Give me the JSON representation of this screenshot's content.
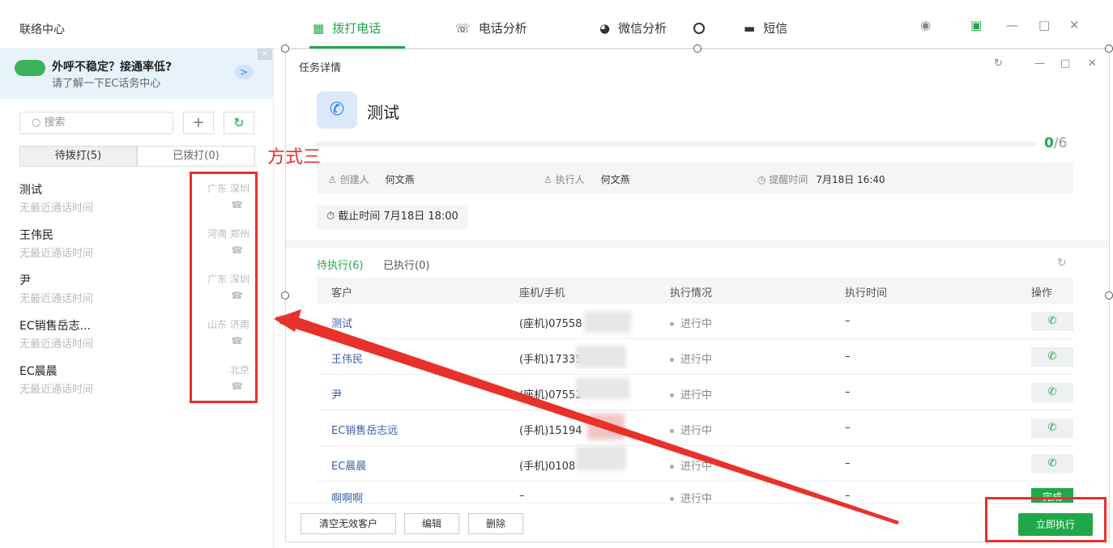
{
  "app": {
    "title": "联络中心"
  },
  "nav": {
    "tabs": [
      {
        "label": "拨打电话"
      },
      {
        "label": "电话分析"
      },
      {
        "label": "微信分析"
      },
      {
        "label": "短信"
      }
    ]
  },
  "banner": {
    "title": "外呼不稳定？接通率低?",
    "subtitle": "请了解一下EC话务中心",
    "arrow": ">",
    "close": "×"
  },
  "left": {
    "search_placeholder": "搜索",
    "plus": "+",
    "segments": [
      "待拨打(5)",
      "已拨打(0)"
    ],
    "contacts": [
      {
        "name": "测试",
        "sub": "无最近通话时间",
        "location": "广东 深圳"
      },
      {
        "name": "王伟民",
        "sub": "无最近通话时间",
        "location": "河南 郑州"
      },
      {
        "name": "尹",
        "sub": "无最近通话时间",
        "location": "广东 深圳"
      },
      {
        "name": "EC销售岳志...",
        "sub": "无最近通话时间",
        "location": "山东 济南"
      },
      {
        "name": "EC晨晨",
        "sub": "无最近通话时间",
        "location": "北京"
      }
    ]
  },
  "annotation": {
    "text": "方式三"
  },
  "dialog": {
    "title": "任务详情",
    "task_name": "测试",
    "progress": {
      "done": "0",
      "total": "/6"
    },
    "creator_label": "创建人",
    "creator": "何文燕",
    "executor_label": "执行人",
    "executor": "何文燕",
    "remind_label": "提醒时间",
    "remind_time": "7月18日 16:40",
    "deadline": "截止时间 7月18日 18:00",
    "subtabs": [
      "待执行(6)",
      "已执行(0)"
    ],
    "columns": [
      "客户",
      "座机/手机",
      "执行情况",
      "执行时间",
      "操作"
    ],
    "rows": [
      {
        "customer": "测试",
        "phone": "(座机)07558",
        "status": "进行中",
        "time": "–"
      },
      {
        "customer": "王伟民",
        "phone": "(手机)17335",
        "status": "进行中",
        "time": "–"
      },
      {
        "customer": "尹",
        "phone": "(座机)07552",
        "status": "进行中",
        "time": "–"
      },
      {
        "customer": "EC销售岳志远",
        "phone": "(手机)15194",
        "status": "进行中",
        "time": "–"
      },
      {
        "customer": "EC晨晨",
        "phone": "(手机)0108",
        "status": "进行中",
        "time": "–"
      },
      {
        "customer": "啊啊啊",
        "phone": "–",
        "status": "进行中",
        "time": "–"
      }
    ],
    "done_label": "完成",
    "footer": {
      "clear": "清空无效客户",
      "edit": "编辑",
      "delete": "删除",
      "execute": "立即执行"
    }
  },
  "colors": {
    "accent": "#1fa84a",
    "annotation": "#e8312b",
    "link": "#3a5ea8"
  }
}
